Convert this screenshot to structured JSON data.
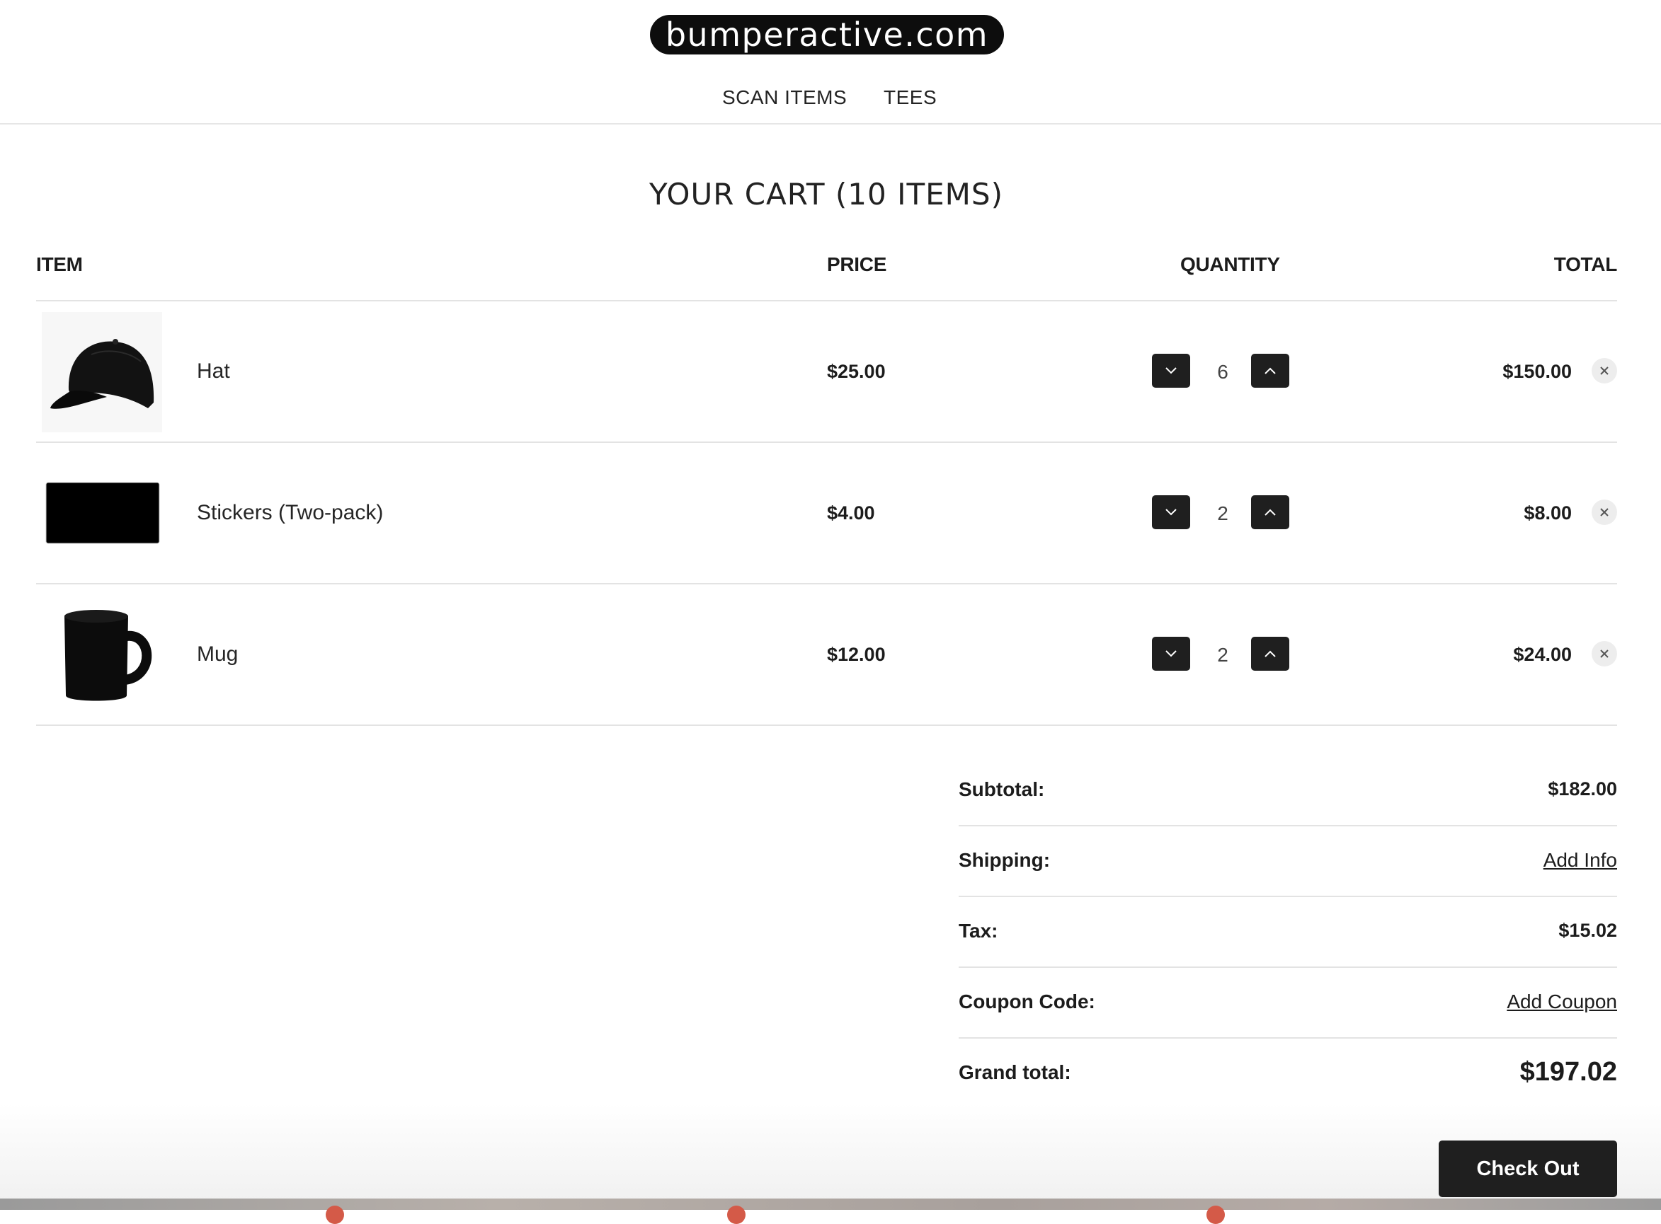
{
  "header": {
    "logo_text": "bumperactive.com",
    "nav": [
      "SCAN ITEMS",
      "TEES"
    ]
  },
  "cart": {
    "title": "YOUR CART (10 ITEMS)",
    "columns": {
      "item": "ITEM",
      "price": "PRICE",
      "quantity": "QUANTITY",
      "total": "TOTAL"
    },
    "items": [
      {
        "name": "Hat",
        "price": "$25.00",
        "quantity": "6",
        "total": "$150.00",
        "image": "black-cap-image"
      },
      {
        "name": "Stickers (Two-pack)",
        "price": "$4.00",
        "quantity": "2",
        "total": "$8.00",
        "image": "black-sticker-image"
      },
      {
        "name": "Mug",
        "price": "$12.00",
        "quantity": "2",
        "total": "$24.00",
        "image": "black-mug-image"
      }
    ]
  },
  "summary": {
    "subtotal_label": "Subtotal:",
    "subtotal_value": "$182.00",
    "shipping_label": "Shipping:",
    "shipping_link": "Add Info",
    "tax_label": "Tax:",
    "tax_value": "$15.02",
    "coupon_label": "Coupon Code:",
    "coupon_link": "Add Coupon",
    "grand_label": "Grand total:",
    "grand_value": "$197.02"
  },
  "checkout_label": "Check Out",
  "icons": {
    "decrease": "chevron-down-icon",
    "increase": "chevron-up-icon",
    "remove": "close-icon"
  },
  "colors": {
    "button_bg": "#1f1f1f",
    "text": "#1c1c1c",
    "divider": "#e3e3e3"
  }
}
